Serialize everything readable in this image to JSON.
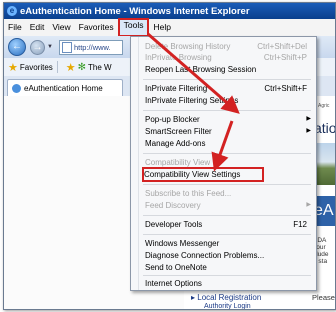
{
  "window": {
    "title": "eAuthentication Home - Windows Internet Explorer"
  },
  "menubar": [
    "File",
    "Edit",
    "View",
    "Favorites",
    "Tools",
    "Help"
  ],
  "address": {
    "value": "http://www."
  },
  "favorites_bar": {
    "favorites_label": "Favorites",
    "suggested_label": "The W"
  },
  "tab": {
    "label": "eAuthentication Home"
  },
  "tools_menu": {
    "items": [
      {
        "label": "Delete Browsing History",
        "shortcut": "Ctrl+Shift+Del",
        "disabled": true
      },
      {
        "label": "InPrivate Browsing",
        "shortcut": "Ctrl+Shift+P",
        "disabled": true
      },
      {
        "label": "Reopen Last Browsing Session"
      },
      {
        "label": "InPrivate Filtering",
        "shortcut": "Ctrl+Shift+F"
      },
      {
        "label": "InPrivate Filtering Settings"
      },
      {
        "label": "Pop-up Blocker",
        "submenu": true
      },
      {
        "label": "SmartScreen Filter",
        "submenu": true
      },
      {
        "label": "Manage Add-ons"
      },
      {
        "label": "Compatibility View",
        "disabled": true
      },
      {
        "label": "Compatibility View Settings",
        "highlighted": true
      },
      {
        "label": "Subscribe to this Feed...",
        "disabled": true
      },
      {
        "label": "Feed Discovery",
        "disabled": true,
        "submenu": true
      },
      {
        "label": "Developer Tools",
        "shortcut": "F12"
      },
      {
        "label": "Windows Messenger"
      },
      {
        "label": "Diagnose Connection Problems..."
      },
      {
        "label": "Send to OneNote"
      },
      {
        "label": "Internet Options"
      }
    ]
  },
  "page": {
    "agric": "Agric",
    "heading_fragment": "atio",
    "banner_letter": "eA",
    "side_text": [
      "SDA",
      "cour",
      "clude",
      "e sta"
    ],
    "link_local_registration": "Local Registration",
    "link_authority_login": "Authority Login",
    "please": "Please"
  },
  "colors": {
    "highlight_red": "#d32222",
    "title_blue": "#0a3f8d"
  }
}
